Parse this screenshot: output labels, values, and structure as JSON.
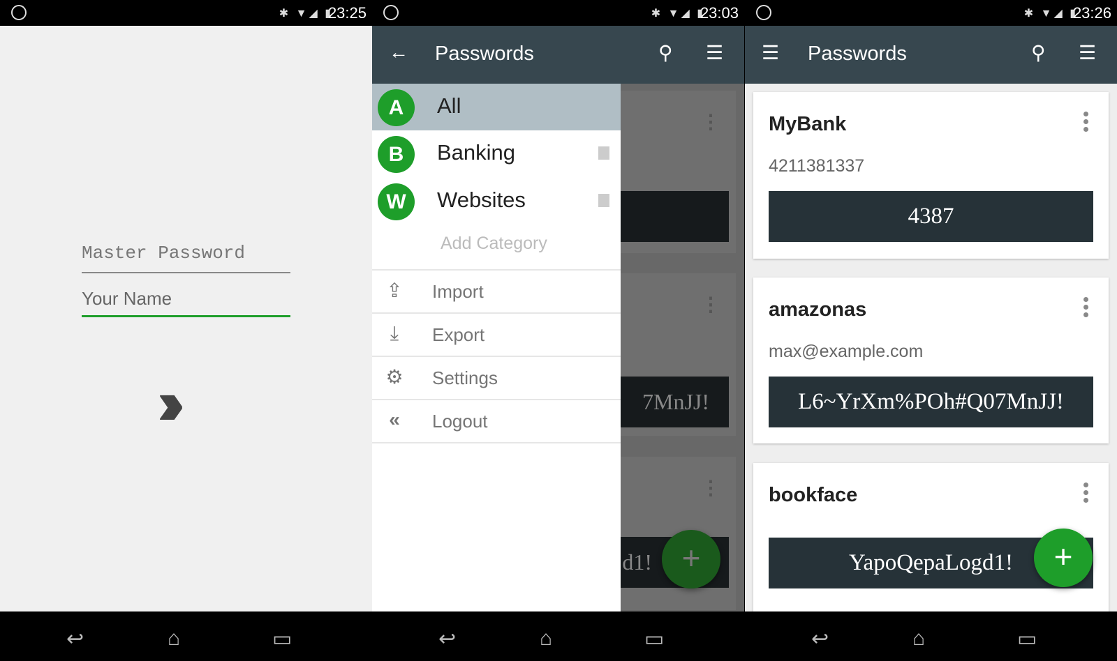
{
  "screens": [
    {
      "status": {
        "time": "23:25",
        "battery": "68"
      },
      "login": {
        "master_password_placeholder": "Master Password",
        "name_value": "Your Name",
        "submit_icon": "double-chevron-right-icon"
      }
    },
    {
      "status": {
        "time": "23:03",
        "battery": "57"
      },
      "toolbar": {
        "title": "Passwords"
      },
      "drawer": {
        "categories": [
          {
            "letter": "A",
            "label": "All",
            "selected": true
          },
          {
            "letter": "B",
            "label": "Banking"
          },
          {
            "letter": "W",
            "label": "Websites"
          }
        ],
        "add_category": "Add Category",
        "menu": [
          {
            "label": "Import",
            "icon": "upload-icon"
          },
          {
            "label": "Export",
            "icon": "download-icon"
          },
          {
            "label": "Settings",
            "icon": "gear-icon"
          },
          {
            "label": "Logout",
            "icon": "double-chevron-left-icon"
          }
        ]
      },
      "behind": {
        "pw2": "7MnJJ!",
        "pw3": "d1!"
      }
    },
    {
      "status": {
        "time": "23:26",
        "battery": "68"
      },
      "toolbar": {
        "title": "Passwords"
      },
      "entries": [
        {
          "name": "MyBank",
          "username": "4211381337",
          "password": "4387"
        },
        {
          "name": "amazonas",
          "username": "max@example.com",
          "password": "L6~YrXm%POh#Q07MnJJ!"
        },
        {
          "name": "bookface",
          "username": "",
          "password": "YapoQepaLogd1!"
        }
      ]
    }
  ],
  "colors": {
    "accent": "#1e9e2a",
    "toolbar": "#37474f",
    "password_bg": "#263238"
  },
  "fab_label": "+"
}
